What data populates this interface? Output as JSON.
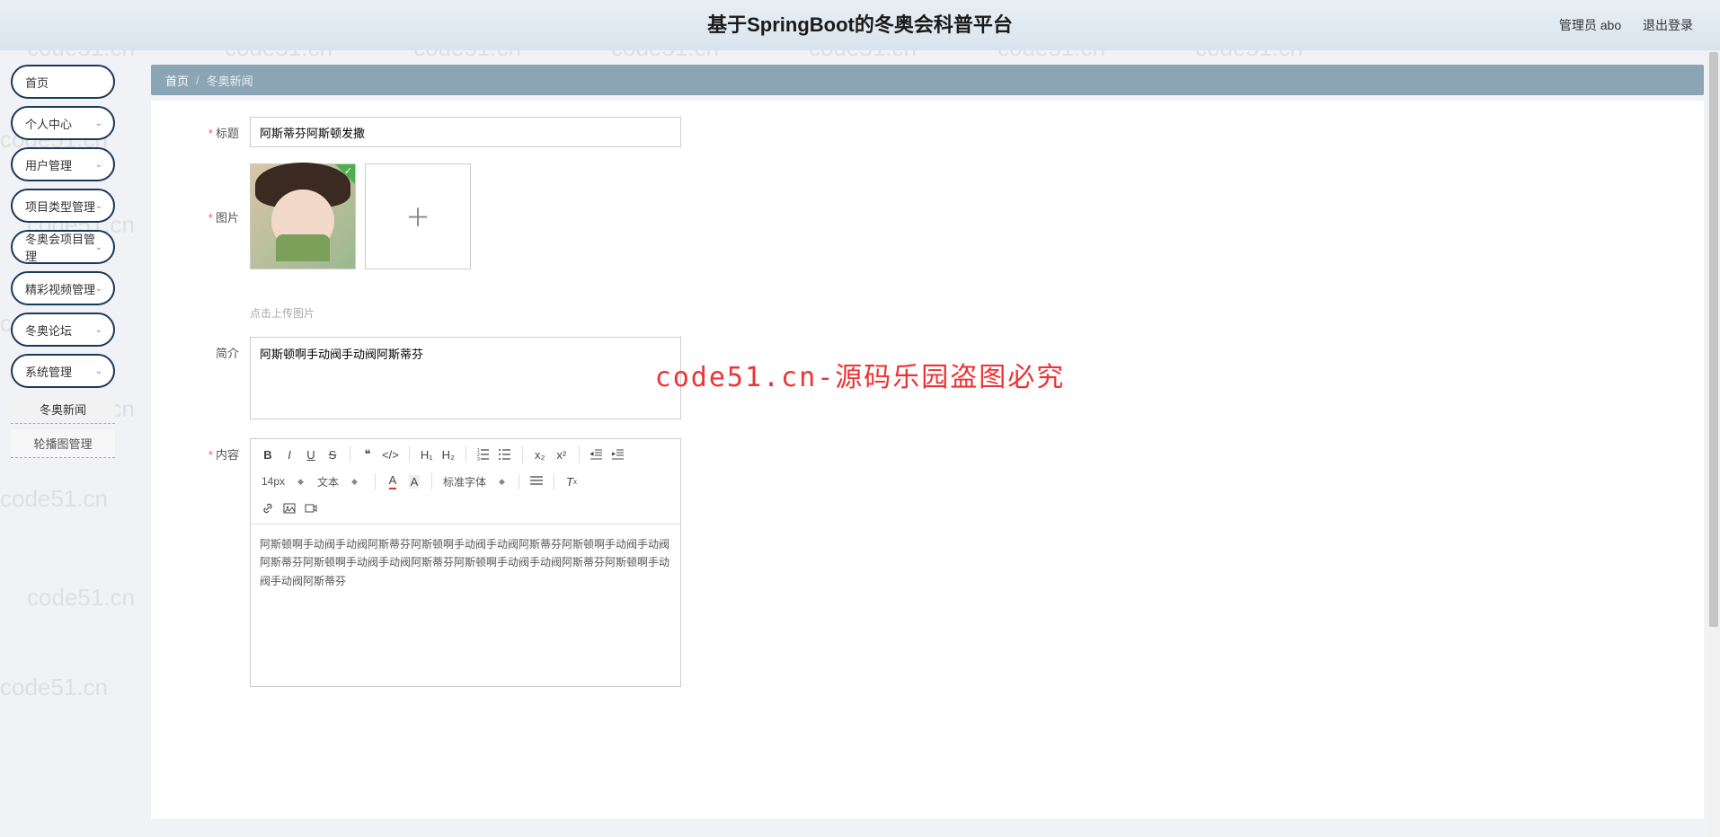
{
  "header": {
    "title": "基于SpringBoot的冬奥会科普平台",
    "admin_label": "管理员 abo",
    "logout": "退出登录"
  },
  "breadcrumb": {
    "home": "首页",
    "current": "冬奥新闻"
  },
  "sidebar": {
    "items": [
      {
        "label": "首页",
        "expandable": false
      },
      {
        "label": "个人中心",
        "expandable": true
      },
      {
        "label": "用户管理",
        "expandable": true
      },
      {
        "label": "项目类型管理",
        "expandable": true
      },
      {
        "label": "冬奥会项目管理",
        "expandable": true
      },
      {
        "label": "精彩视频管理",
        "expandable": true
      },
      {
        "label": "冬奥论坛",
        "expandable": true
      },
      {
        "label": "系统管理",
        "expandable": true
      }
    ],
    "subitems": [
      {
        "label": "冬奥新闻",
        "active": true
      },
      {
        "label": "轮播图管理",
        "active": false
      }
    ]
  },
  "form": {
    "title_label": "标题",
    "title_value": "阿斯蒂芬阿斯顿发撒",
    "image_label": "图片",
    "upload_hint": "点击上传图片",
    "intro_label": "简介",
    "intro_value": "阿斯顿啊手动阀手动阀阿斯蒂芬",
    "content_label": "内容",
    "content_value": "阿斯顿啊手动阀手动阀阿斯蒂芬阿斯顿啊手动阀手动阀阿斯蒂芬阿斯顿啊手动阀手动阀阿斯蒂芬阿斯顿啊手动阀手动阀阿斯蒂芬阿斯顿啊手动阀手动阀阿斯蒂芬阿斯顿啊手动阀手动阀阿斯蒂芬"
  },
  "editor_toolbar": {
    "font_size": "14px",
    "text_type": "文本",
    "font_family": "标准字体"
  },
  "watermark_text": "code51.cn",
  "center_overlay": "code51.cn-源码乐园盗图必究"
}
